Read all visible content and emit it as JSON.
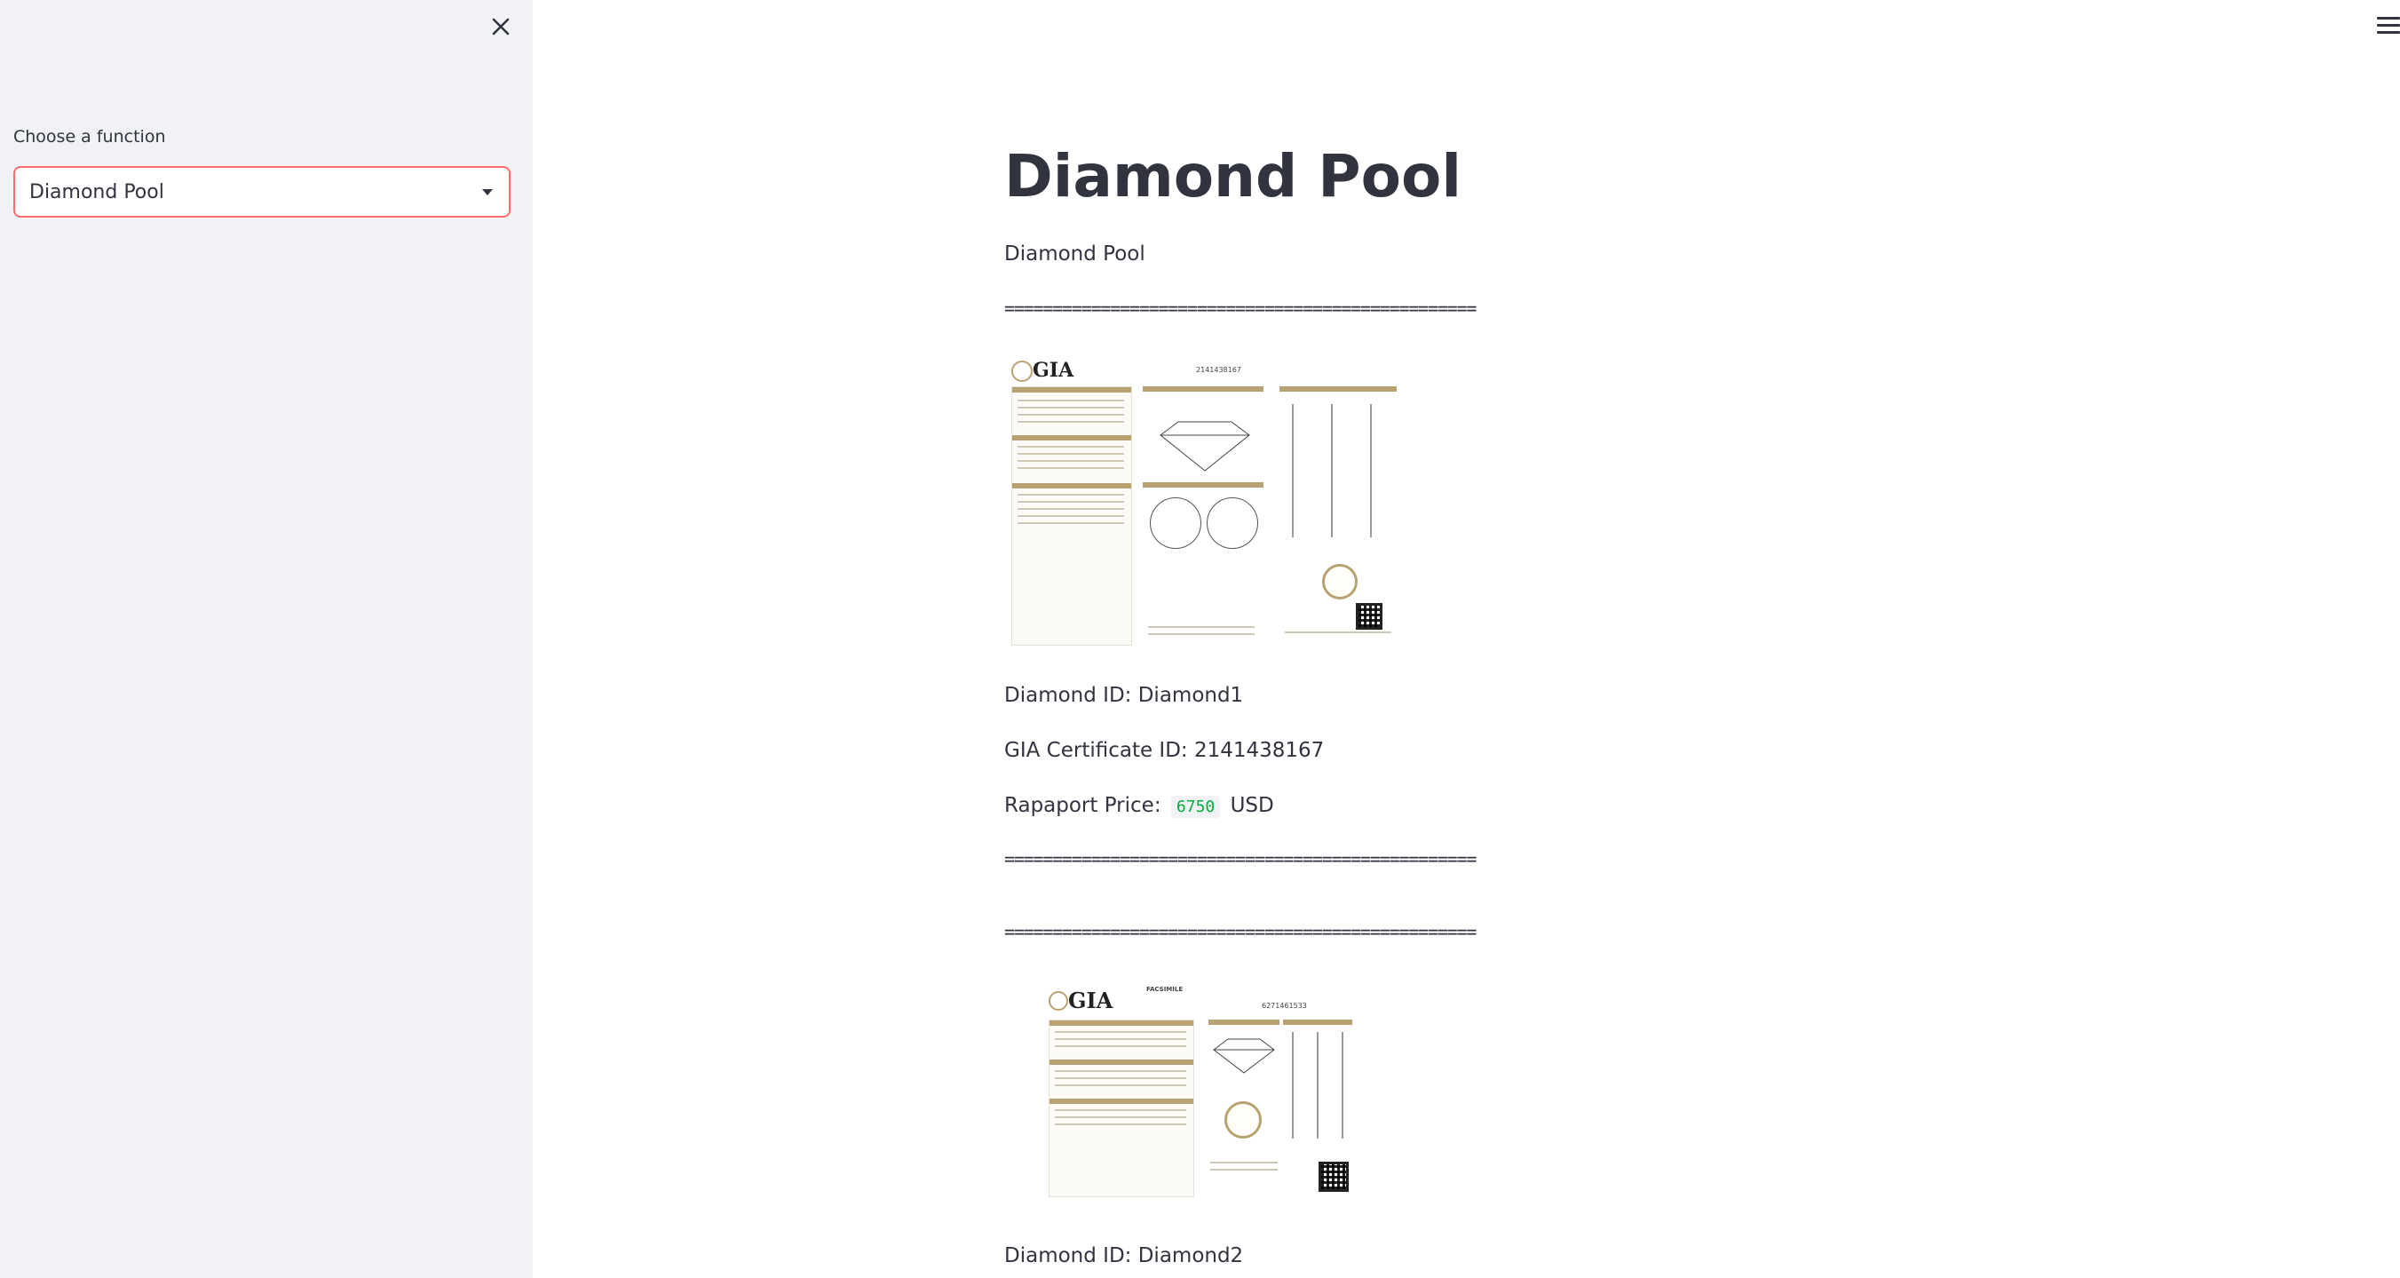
{
  "sidebar": {
    "label": "Choose a function",
    "select_value": "Diamond Pool"
  },
  "main": {
    "title": "Diamond Pool",
    "subtitle": "Diamond Pool",
    "separator": "=================================================",
    "diamonds": [
      {
        "id_text": "Diamond ID: Diamond1",
        "cert_text": "GIA Certificate ID: 2141438167",
        "price_label": "Rapaport Price:",
        "price_value": "6750",
        "price_unit": "USD",
        "cert_image_text": "GIA",
        "cert_image_number": "2141438167"
      },
      {
        "id_text": "Diamond ID: Diamond2",
        "cert_image_text": "GIA",
        "cert_image_number": "6271461533",
        "cert_image_heading": "FACSIMILE"
      }
    ]
  },
  "colors": {
    "sidebar_bg": "#f0f2f6",
    "select_border": "#ff6c6c",
    "price_green": "#09ab3b",
    "gia_gold": "#b8a272"
  }
}
